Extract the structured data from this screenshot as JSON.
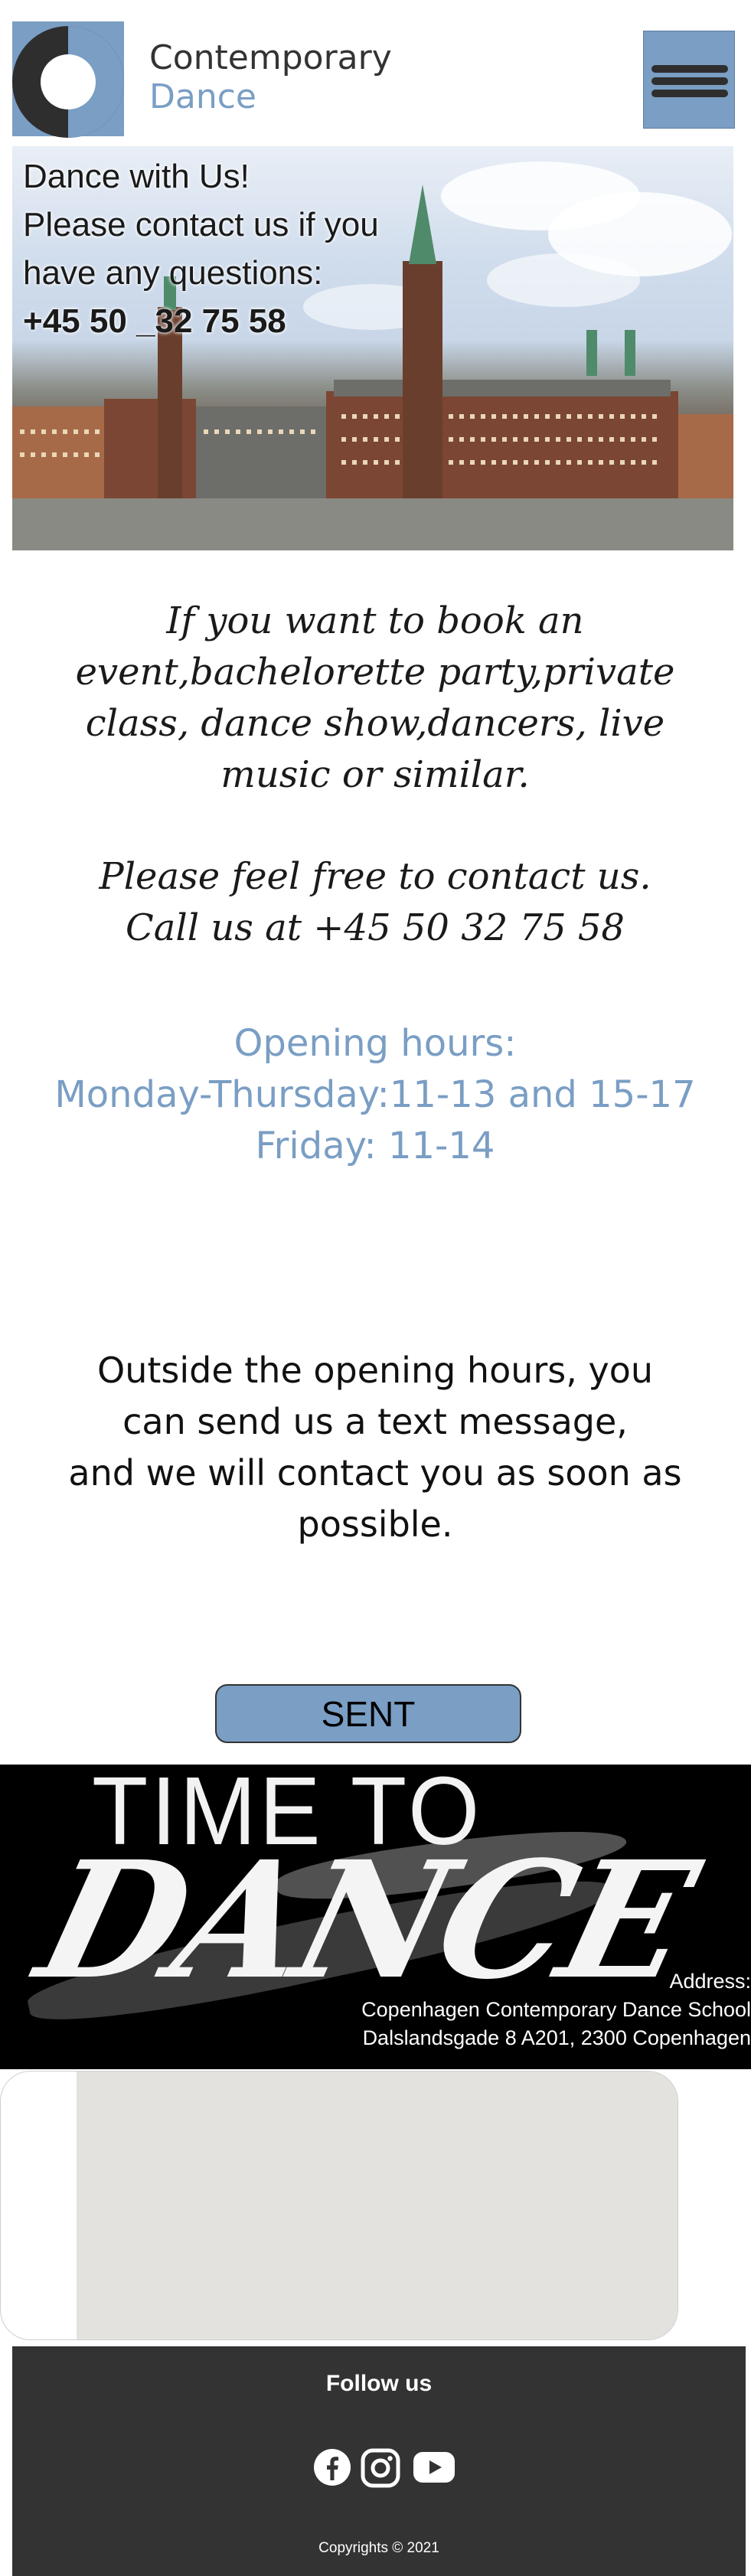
{
  "header": {
    "brand_line1": "Contemporary",
    "brand_line2": "Dance",
    "logo_icon": "ring-logo-icon",
    "menu_icon": "hamburger-menu-icon"
  },
  "hero": {
    "line1": "Dance with Us!",
    "line2": "Please contact us if you",
    "line3": "have any questions:",
    "phone": "+45 50 _32 75 58"
  },
  "booking": {
    "line1": "If you want to book an",
    "line2": "event,bachelorette party,private",
    "line3": "class, dance show,dancers, live",
    "line4": "music or similar.",
    "contact_line1": "Please feel free to contact us.",
    "contact_line2": "Call us at +45 50 32 75 58"
  },
  "hours": {
    "title": "Opening hours:",
    "weekdays": "Monday-Thursday:11-13 and 15-17",
    "friday": "Friday: 11-14"
  },
  "outside": {
    "line1": "Outside the opening hours, you",
    "line2": "can send us a text message,",
    "line3": "and we will contact you as soon as",
    "line4": "possible."
  },
  "form": {
    "sent_label": "SENT"
  },
  "banner": {
    "time_text": "TIME TO",
    "dance_text": "DANCE",
    "address_label": "Address:",
    "school": "Copenhagen Contemporary Dance School",
    "street": "Dalslandsgade 8 A201, 2300 Copenhagen"
  },
  "footer": {
    "follow": "Follow us",
    "socials": [
      "facebook-icon",
      "instagram-icon",
      "youtube-icon"
    ],
    "copyright": "Copyrights © 2021"
  },
  "colors": {
    "accent": "#7a9ec4",
    "dark": "#333333",
    "banner_bg": "#000000"
  }
}
